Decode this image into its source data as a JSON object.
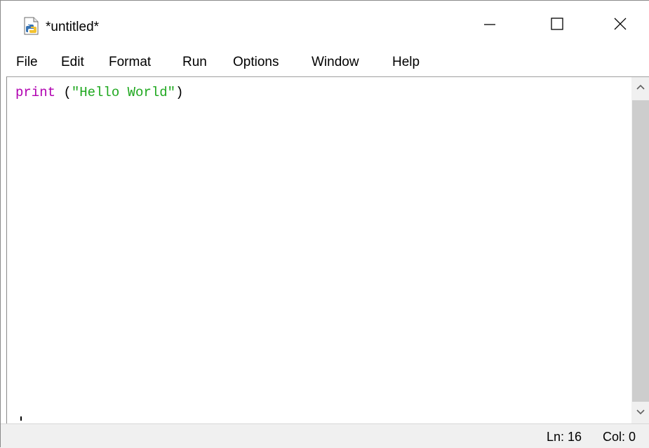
{
  "window": {
    "title": "*untitled*",
    "icon": "python-file-icon",
    "controls": {
      "minimize": "minimize-icon",
      "maximize": "maximize-icon",
      "close": "close-icon"
    }
  },
  "menu": {
    "items": [
      "File",
      "Edit",
      "Format",
      "Run",
      "Options",
      "Window",
      "Help"
    ]
  },
  "editor": {
    "code": {
      "keyword": "print",
      "open": " (",
      "string": "\"Hello World\"",
      "close": ")"
    },
    "colors": {
      "keyword": "#b000b0",
      "string": "#1fa81f",
      "text": "#000000"
    }
  },
  "statusbar": {
    "line": "Ln: 16",
    "column": "Col: 0"
  }
}
